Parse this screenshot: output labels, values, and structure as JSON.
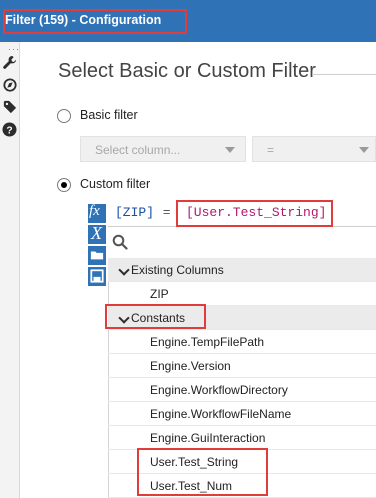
{
  "window": {
    "title": "Filter (159) - Configuration"
  },
  "rail": {
    "icons": [
      "wrench-icon",
      "compass-icon",
      "tag-icon",
      "help-icon"
    ]
  },
  "header": {
    "title": "Select Basic or Custom Filter"
  },
  "basic_filter": {
    "label": "Basic filter",
    "selected": false,
    "column_placeholder": "Select column...",
    "operator_value": "="
  },
  "custom_filter": {
    "label": "Custom filter",
    "selected": true
  },
  "expression": {
    "field": "[ZIP]",
    "operator": " = ",
    "value": "[User.Test_String]"
  },
  "colors": {
    "accent": "#2f73b6",
    "highlight_box": "#e03c3c",
    "expr_field": "#1a4ea8",
    "expr_operator": "#555555",
    "expr_value": "#b3186e"
  },
  "search": {
    "icon": "search-icon",
    "value": ""
  },
  "tree": {
    "existing_columns": {
      "label": "Existing Columns",
      "expanded": true,
      "items": [
        "ZIP"
      ]
    },
    "constants": {
      "label": "Constants",
      "expanded": true,
      "items": [
        "Engine.TempFilePath",
        "Engine.Version",
        "Engine.WorkflowDirectory",
        "Engine.WorkflowFileName",
        "Engine.GuiInteraction",
        "User.Test_String",
        "User.Test_Num"
      ]
    }
  }
}
